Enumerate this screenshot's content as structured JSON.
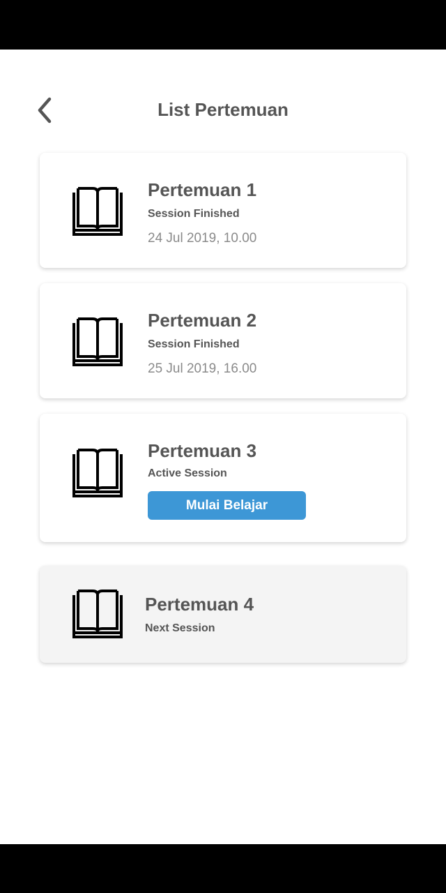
{
  "header": {
    "title": "List Pertemuan",
    "back_icon": "chevron-left-icon"
  },
  "sessions": [
    {
      "title": "Pertemuan 1",
      "status": "Session Finished",
      "date": "24 Jul 2019, 10.00",
      "icon": "book-icon"
    },
    {
      "title": "Pertemuan 2",
      "status": "Session Finished",
      "date": "25 Jul 2019, 16.00",
      "icon": "book-icon"
    },
    {
      "title": "Pertemuan 3",
      "status": "Active Session",
      "button_label": "Mulai Belajar",
      "icon": "book-icon"
    },
    {
      "title": "Pertemuan 4",
      "status": "Next Session",
      "icon": "book-icon"
    }
  ],
  "colors": {
    "accent": "#3d97d6",
    "text": "#555555",
    "muted": "#8a8a8a",
    "disabled_card": "#f4f4f4"
  }
}
